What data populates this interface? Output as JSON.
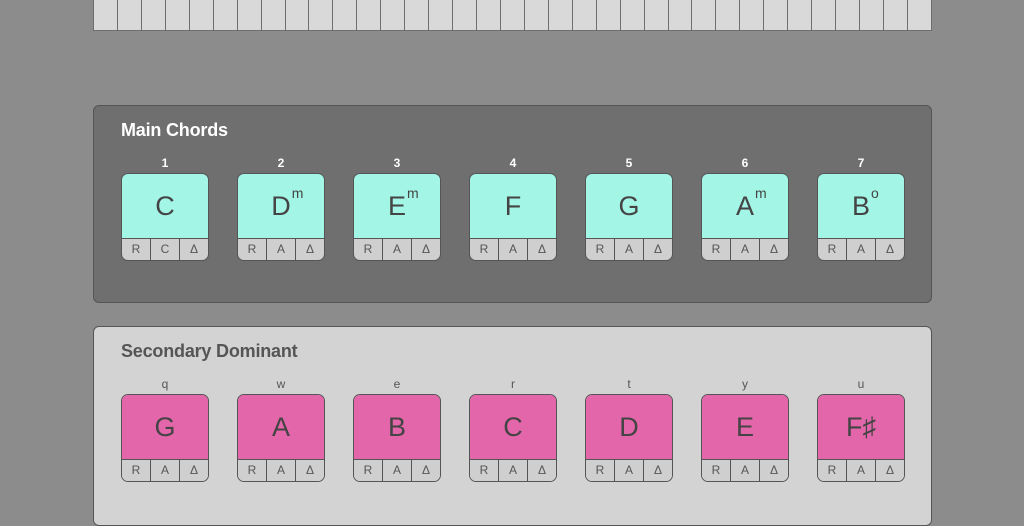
{
  "keyboard": {
    "key_count": 35
  },
  "main_chords": {
    "title": "Main Chords",
    "chords": [
      {
        "key": "1",
        "root": "C",
        "quality": "",
        "buttons": [
          "R",
          "C",
          "Δ"
        ]
      },
      {
        "key": "2",
        "root": "D",
        "quality": "m",
        "buttons": [
          "R",
          "A",
          "Δ"
        ]
      },
      {
        "key": "3",
        "root": "E",
        "quality": "m",
        "buttons": [
          "R",
          "A",
          "Δ"
        ]
      },
      {
        "key": "4",
        "root": "F",
        "quality": "",
        "buttons": [
          "R",
          "A",
          "Δ"
        ]
      },
      {
        "key": "5",
        "root": "G",
        "quality": "",
        "buttons": [
          "R",
          "A",
          "Δ"
        ]
      },
      {
        "key": "6",
        "root": "A",
        "quality": "m",
        "buttons": [
          "R",
          "A",
          "Δ"
        ]
      },
      {
        "key": "7",
        "root": "B",
        "quality": "o",
        "buttons": [
          "R",
          "A",
          "Δ"
        ]
      }
    ]
  },
  "secondary_dominant": {
    "title": "Secondary Dominant",
    "chords": [
      {
        "key": "q",
        "root": "G",
        "quality": "",
        "buttons": [
          "R",
          "A",
          "Δ"
        ]
      },
      {
        "key": "w",
        "root": "A",
        "quality": "",
        "buttons": [
          "R",
          "A",
          "Δ"
        ]
      },
      {
        "key": "e",
        "root": "B",
        "quality": "",
        "buttons": [
          "R",
          "A",
          "Δ"
        ]
      },
      {
        "key": "r",
        "root": "C",
        "quality": "",
        "buttons": [
          "R",
          "A",
          "Δ"
        ]
      },
      {
        "key": "t",
        "root": "D",
        "quality": "",
        "buttons": [
          "R",
          "A",
          "Δ"
        ]
      },
      {
        "key": "y",
        "root": "E",
        "quality": "",
        "buttons": [
          "R",
          "A",
          "Δ"
        ]
      },
      {
        "key": "u",
        "root": "F♯",
        "quality": "",
        "buttons": [
          "R",
          "A",
          "Δ"
        ]
      }
    ]
  },
  "colors": {
    "background": "#8c8c8c",
    "main_panel": "#6f6f6f",
    "main_pad": "#a3f5e6",
    "secondary_panel": "#d3d3d3",
    "secondary_pad": "#e366aa"
  }
}
